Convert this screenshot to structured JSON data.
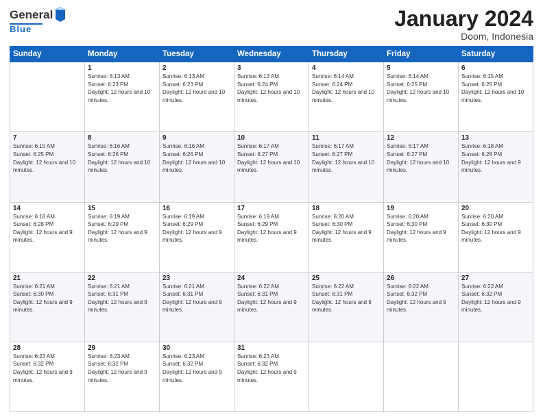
{
  "header": {
    "logo_general": "General",
    "logo_blue": "Blue",
    "month": "January 2024",
    "location": "Doom, Indonesia"
  },
  "weekdays": [
    "Sunday",
    "Monday",
    "Tuesday",
    "Wednesday",
    "Thursday",
    "Friday",
    "Saturday"
  ],
  "weeks": [
    [
      {
        "day": "",
        "sunrise": "",
        "sunset": "",
        "daylight": ""
      },
      {
        "day": "1",
        "sunrise": "Sunrise: 6:13 AM",
        "sunset": "Sunset: 6:23 PM",
        "daylight": "Daylight: 12 hours and 10 minutes."
      },
      {
        "day": "2",
        "sunrise": "Sunrise: 6:13 AM",
        "sunset": "Sunset: 6:23 PM",
        "daylight": "Daylight: 12 hours and 10 minutes."
      },
      {
        "day": "3",
        "sunrise": "Sunrise: 6:13 AM",
        "sunset": "Sunset: 6:24 PM",
        "daylight": "Daylight: 12 hours and 10 minutes."
      },
      {
        "day": "4",
        "sunrise": "Sunrise: 6:14 AM",
        "sunset": "Sunset: 6:24 PM",
        "daylight": "Daylight: 12 hours and 10 minutes."
      },
      {
        "day": "5",
        "sunrise": "Sunrise: 6:14 AM",
        "sunset": "Sunset: 6:25 PM",
        "daylight": "Daylight: 12 hours and 10 minutes."
      },
      {
        "day": "6",
        "sunrise": "Sunrise: 6:15 AM",
        "sunset": "Sunset: 6:25 PM",
        "daylight": "Daylight: 12 hours and 10 minutes."
      }
    ],
    [
      {
        "day": "7",
        "sunrise": "Sunrise: 6:15 AM",
        "sunset": "Sunset: 6:25 PM",
        "daylight": "Daylight: 12 hours and 10 minutes."
      },
      {
        "day": "8",
        "sunrise": "Sunrise: 6:16 AM",
        "sunset": "Sunset: 6:26 PM",
        "daylight": "Daylight: 12 hours and 10 minutes."
      },
      {
        "day": "9",
        "sunrise": "Sunrise: 6:16 AM",
        "sunset": "Sunset: 6:26 PM",
        "daylight": "Daylight: 12 hours and 10 minutes."
      },
      {
        "day": "10",
        "sunrise": "Sunrise: 6:17 AM",
        "sunset": "Sunset: 6:27 PM",
        "daylight": "Daylight: 12 hours and 10 minutes."
      },
      {
        "day": "11",
        "sunrise": "Sunrise: 6:17 AM",
        "sunset": "Sunset: 6:27 PM",
        "daylight": "Daylight: 12 hours and 10 minutes."
      },
      {
        "day": "12",
        "sunrise": "Sunrise: 6:17 AM",
        "sunset": "Sunset: 6:27 PM",
        "daylight": "Daylight: 12 hours and 10 minutes."
      },
      {
        "day": "13",
        "sunrise": "Sunrise: 6:18 AM",
        "sunset": "Sunset: 6:28 PM",
        "daylight": "Daylight: 12 hours and 9 minutes."
      }
    ],
    [
      {
        "day": "14",
        "sunrise": "Sunrise: 6:18 AM",
        "sunset": "Sunset: 6:28 PM",
        "daylight": "Daylight: 12 hours and 9 minutes."
      },
      {
        "day": "15",
        "sunrise": "Sunrise: 6:19 AM",
        "sunset": "Sunset: 6:29 PM",
        "daylight": "Daylight: 12 hours and 9 minutes."
      },
      {
        "day": "16",
        "sunrise": "Sunrise: 6:19 AM",
        "sunset": "Sunset: 6:29 PM",
        "daylight": "Daylight: 12 hours and 9 minutes."
      },
      {
        "day": "17",
        "sunrise": "Sunrise: 6:19 AM",
        "sunset": "Sunset: 6:29 PM",
        "daylight": "Daylight: 12 hours and 9 minutes."
      },
      {
        "day": "18",
        "sunrise": "Sunrise: 6:20 AM",
        "sunset": "Sunset: 6:30 PM",
        "daylight": "Daylight: 12 hours and 9 minutes."
      },
      {
        "day": "19",
        "sunrise": "Sunrise: 6:20 AM",
        "sunset": "Sunset: 6:30 PM",
        "daylight": "Daylight: 12 hours and 9 minutes."
      },
      {
        "day": "20",
        "sunrise": "Sunrise: 6:20 AM",
        "sunset": "Sunset: 6:30 PM",
        "daylight": "Daylight: 12 hours and 9 minutes."
      }
    ],
    [
      {
        "day": "21",
        "sunrise": "Sunrise: 6:21 AM",
        "sunset": "Sunset: 6:30 PM",
        "daylight": "Daylight: 12 hours and 9 minutes."
      },
      {
        "day": "22",
        "sunrise": "Sunrise: 6:21 AM",
        "sunset": "Sunset: 6:31 PM",
        "daylight": "Daylight: 12 hours and 9 minutes."
      },
      {
        "day": "23",
        "sunrise": "Sunrise: 6:21 AM",
        "sunset": "Sunset: 6:31 PM",
        "daylight": "Daylight: 12 hours and 9 minutes."
      },
      {
        "day": "24",
        "sunrise": "Sunrise: 6:22 AM",
        "sunset": "Sunset: 6:31 PM",
        "daylight": "Daylight: 12 hours and 9 minutes."
      },
      {
        "day": "25",
        "sunrise": "Sunrise: 6:22 AM",
        "sunset": "Sunset: 6:31 PM",
        "daylight": "Daylight: 12 hours and 9 minutes."
      },
      {
        "day": "26",
        "sunrise": "Sunrise: 6:22 AM",
        "sunset": "Sunset: 6:32 PM",
        "daylight": "Daylight: 12 hours and 9 minutes."
      },
      {
        "day": "27",
        "sunrise": "Sunrise: 6:22 AM",
        "sunset": "Sunset: 6:32 PM",
        "daylight": "Daylight: 12 hours and 9 minutes."
      }
    ],
    [
      {
        "day": "28",
        "sunrise": "Sunrise: 6:23 AM",
        "sunset": "Sunset: 6:32 PM",
        "daylight": "Daylight: 12 hours and 9 minutes."
      },
      {
        "day": "29",
        "sunrise": "Sunrise: 6:23 AM",
        "sunset": "Sunset: 6:32 PM",
        "daylight": "Daylight: 12 hours and 9 minutes."
      },
      {
        "day": "30",
        "sunrise": "Sunrise: 6:23 AM",
        "sunset": "Sunset: 6:32 PM",
        "daylight": "Daylight: 12 hours and 9 minutes."
      },
      {
        "day": "31",
        "sunrise": "Sunrise: 6:23 AM",
        "sunset": "Sunset: 6:32 PM",
        "daylight": "Daylight: 12 hours and 9 minutes."
      },
      {
        "day": "",
        "sunrise": "",
        "sunset": "",
        "daylight": ""
      },
      {
        "day": "",
        "sunrise": "",
        "sunset": "",
        "daylight": ""
      },
      {
        "day": "",
        "sunrise": "",
        "sunset": "",
        "daylight": ""
      }
    ]
  ]
}
